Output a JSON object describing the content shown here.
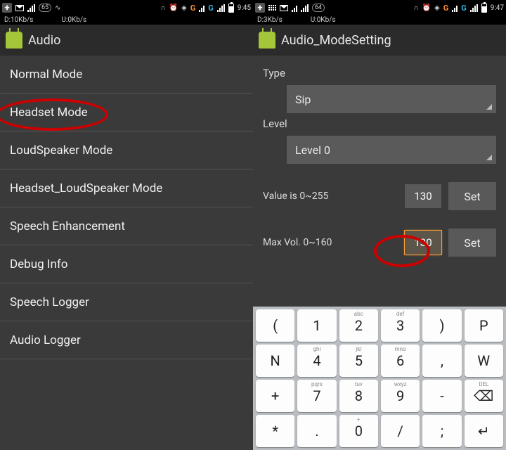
{
  "left": {
    "status": {
      "down": "D:10Kb/s",
      "up": "U:0Kb/s",
      "battery": "65",
      "time": "9:45",
      "g1": "G",
      "g2": "G"
    },
    "title": "Audio",
    "items": [
      "Normal Mode",
      "Headset Mode",
      "LoudSpeaker Mode",
      "Headset_LoudSpeaker Mode",
      "Speech Enhancement",
      "Debug Info",
      "Speech Logger",
      "Audio Logger"
    ]
  },
  "right": {
    "status": {
      "down": "D:3Kb/s",
      "up": "U:0Kb/s",
      "battery": "64",
      "time": "9:47",
      "g1": "G",
      "g2": "G"
    },
    "title": "Audio_ModeSetting",
    "type_label": "Type",
    "type_value": "Sip",
    "level_label": "Level",
    "level_value": "Level 0",
    "value_label": "Value is 0~255",
    "value_val": "130",
    "maxvol_label": "Max Vol. 0~160",
    "maxvol_val": "130",
    "set_label": "Set"
  },
  "keypad": {
    "r1": [
      {
        "main": "(",
        "sup": ""
      },
      {
        "main": "1",
        "sup": ""
      },
      {
        "main": "2",
        "sup": "abc"
      },
      {
        "main": "3",
        "sup": "def"
      },
      {
        "main": ")",
        "sup": ""
      },
      {
        "main": "P",
        "sup": ""
      }
    ],
    "r2": [
      {
        "main": "N",
        "sup": ""
      },
      {
        "main": "4",
        "sup": "ghi"
      },
      {
        "main": "5",
        "sup": "jkl"
      },
      {
        "main": "6",
        "sup": "mno"
      },
      {
        "main": ",",
        "sup": ""
      },
      {
        "main": "W",
        "sup": ""
      }
    ],
    "r3": [
      {
        "main": "+",
        "sup": ""
      },
      {
        "main": "7",
        "sup": "pqrs"
      },
      {
        "main": "8",
        "sup": "tuv"
      },
      {
        "main": "9",
        "sup": "wxyz"
      },
      {
        "main": "-",
        "sup": ""
      },
      {
        "main": "⌫",
        "sup": "DEL"
      }
    ],
    "r4": [
      {
        "main": "*",
        "sup": ""
      },
      {
        "main": ".",
        "sup": ""
      },
      {
        "main": "0",
        "sup": "+"
      },
      {
        "main": "/",
        "sup": ""
      },
      {
        "main": ";",
        "sup": ""
      },
      {
        "main": "↵",
        "sup": ""
      }
    ]
  }
}
